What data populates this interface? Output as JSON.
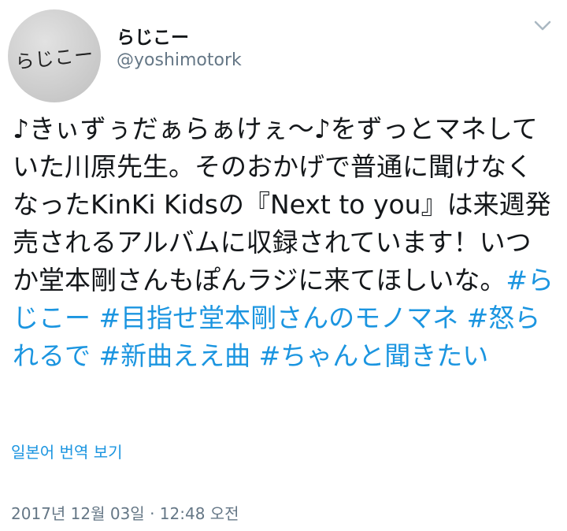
{
  "author": {
    "avatar_text": "らじこー",
    "display_name": "らじこー",
    "handle": "@yoshimotork"
  },
  "menu": {
    "icon": "chevron-down-icon"
  },
  "tweet": {
    "text": "♪きぃずぅだぁらぁけぇ〜♪をずっとマネしていた川原先生。そのおかげで普通に聞けなくなったKinKi Kidsの『Next to you』は来週発売されるアルバムに収録されています！いつか堂本剛さんもぽんラジに来てほしいな。",
    "hashtags": [
      "#らじこー",
      "#目指せ堂本剛さんのモノマネ",
      "#怒られるで",
      "#新曲ええ曲",
      "#ちゃんと聞きたい"
    ]
  },
  "translate_label": "일본어 번역 보기",
  "timestamp": "2017년 12월 03일 · 12:48 오전",
  "colors": {
    "link": "#1b95e0",
    "text": "#14171a",
    "secondary": "#657786"
  }
}
